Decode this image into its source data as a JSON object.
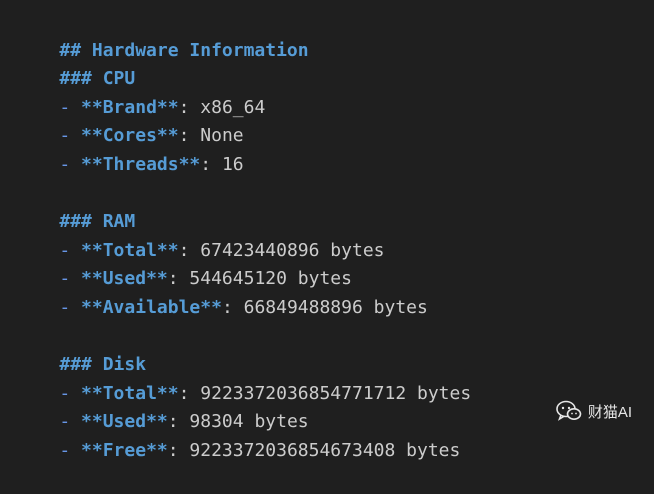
{
  "document": {
    "lines": [
      {
        "type": "heading",
        "text": "## Hardware Information"
      },
      {
        "type": "heading",
        "text": "### CPU"
      },
      {
        "type": "item",
        "key": "**Brand**",
        "value": ": x86_64"
      },
      {
        "type": "item",
        "key": "**Cores**",
        "value": ": None"
      },
      {
        "type": "item",
        "key": "**Threads**",
        "value": ": 16"
      },
      {
        "type": "blank",
        "text": ""
      },
      {
        "type": "heading",
        "text": "### RAM"
      },
      {
        "type": "item",
        "key": "**Total**",
        "value": ": 67423440896 bytes"
      },
      {
        "type": "item",
        "key": "**Used**",
        "value": ": 544645120 bytes"
      },
      {
        "type": "item",
        "key": "**Available**",
        "value": ": 66849488896 bytes"
      },
      {
        "type": "blank",
        "text": ""
      },
      {
        "type": "heading",
        "text": "### Disk"
      },
      {
        "type": "item",
        "key": "**Total**",
        "value": ": 9223372036854771712 bytes"
      },
      {
        "type": "item",
        "key": "**Used**",
        "value": ": 98304 bytes"
      },
      {
        "type": "item",
        "key": "**Free**",
        "value": ": 9223372036854673408 bytes"
      }
    ],
    "bullet_marker": "- "
  },
  "watermark": {
    "icon": "wechat-icon",
    "text": "财猫AI"
  },
  "colors": {
    "background": "#1f1f1f",
    "heading": "#569cd6",
    "bullet": "#6796e6",
    "text": "#cccccc"
  }
}
